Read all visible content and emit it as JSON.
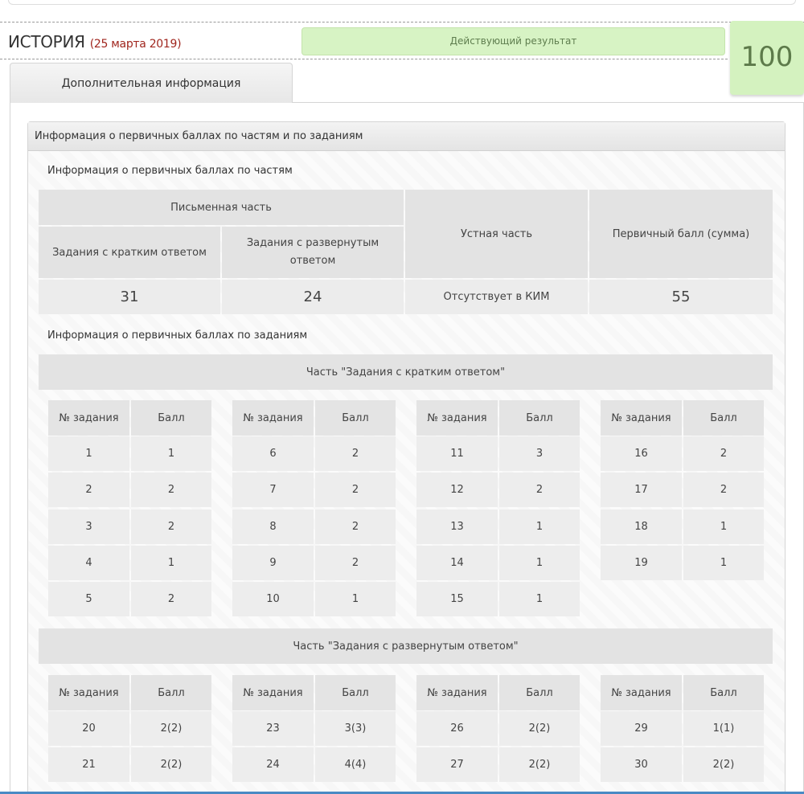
{
  "subject": {
    "name": "ИСТОРИЯ",
    "date": "(25 марта 2019)"
  },
  "status": "Действующий результат",
  "score": "100",
  "tab": "Дополнительная информация",
  "panel_title": "Информация о первичных баллах по частям и по заданиям",
  "parts": {
    "title": "Информация о первичных баллах по частям",
    "written_header": "Письменная часть",
    "short_header": "Задания с кратким ответом",
    "extended_header": "Задания с развернутым ответом",
    "oral_header": "Устная часть",
    "total_header": "Первичный балл (сумма)",
    "short_value": "31",
    "extended_value": "24",
    "oral_value": "Отсутствует в КИМ",
    "total_value": "55"
  },
  "tasks": {
    "title": "Информация о первичных баллах по заданиям",
    "col_task": "№ задания",
    "col_score": "Балл",
    "short": {
      "title": "Часть \"Задания с кратким ответом\"",
      "columns": [
        [
          [
            "1",
            "1"
          ],
          [
            "2",
            "2"
          ],
          [
            "3",
            "2"
          ],
          [
            "4",
            "1"
          ],
          [
            "5",
            "2"
          ]
        ],
        [
          [
            "6",
            "2"
          ],
          [
            "7",
            "2"
          ],
          [
            "8",
            "2"
          ],
          [
            "9",
            "2"
          ],
          [
            "10",
            "1"
          ]
        ],
        [
          [
            "11",
            "3"
          ],
          [
            "12",
            "2"
          ],
          [
            "13",
            "1"
          ],
          [
            "14",
            "1"
          ],
          [
            "15",
            "1"
          ]
        ],
        [
          [
            "16",
            "2"
          ],
          [
            "17",
            "2"
          ],
          [
            "18",
            "1"
          ],
          [
            "19",
            "1"
          ]
        ]
      ]
    },
    "extended": {
      "title": "Часть \"Задания с развернутым ответом\"",
      "columns": [
        [
          [
            "20",
            "2(2)"
          ],
          [
            "21",
            "2(2)"
          ]
        ],
        [
          [
            "23",
            "3(3)"
          ],
          [
            "24",
            "4(4)"
          ]
        ],
        [
          [
            "26",
            "2(2)"
          ],
          [
            "27",
            "2(2)"
          ]
        ],
        [
          [
            "29",
            "1(1)"
          ],
          [
            "30",
            "2(2)"
          ]
        ]
      ]
    }
  }
}
